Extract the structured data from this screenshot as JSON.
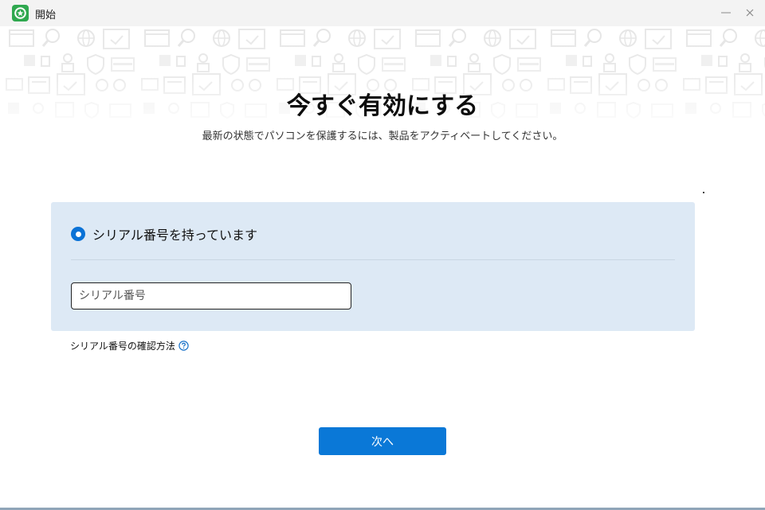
{
  "window": {
    "title": "開始",
    "minimize_glyph": "—",
    "close_glyph": "✕"
  },
  "hero": {
    "title": "今すぐ有効にする",
    "subtitle": "最新の状態でパソコンを保護するには、製品をアクティベートしてください。"
  },
  "activation": {
    "option_label": "シリアル番号を持っています",
    "option_selected": true,
    "serial_placeholder": "シリアル番号",
    "serial_value": ""
  },
  "help": {
    "link_label": "シリアル番号の確認方法",
    "icon": "question-circle-icon"
  },
  "footer": {
    "next_label": "次へ"
  },
  "colors": {
    "accent": "#0a78d7",
    "panel_bg": "#dde9f5",
    "app_icon": "#2fa84f"
  }
}
